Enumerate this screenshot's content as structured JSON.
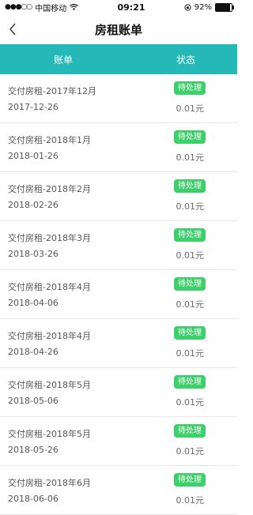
{
  "status_bar": {
    "carrier": "中国移动",
    "time": "09:21",
    "battery": "92%",
    "battery_level": 0.92
  },
  "nav": {
    "title": "房租账单"
  },
  "table_header": {
    "bill": "账单",
    "status": "状态"
  },
  "items": [
    {
      "title": "交付房租-2017年12月",
      "date": "2017-12-26",
      "status": "待处理",
      "amount": "0.01元"
    },
    {
      "title": "交付房租-2018年1月",
      "date": "2018-01-26",
      "status": "待处理",
      "amount": "0.01元"
    },
    {
      "title": "交付房租-2018年2月",
      "date": "2018-02-26",
      "status": "待处理",
      "amount": "0.01元"
    },
    {
      "title": "交付房租-2018年3月",
      "date": "2018-03-26",
      "status": "待处理",
      "amount": "0.01元"
    },
    {
      "title": "交付房租-2018年4月",
      "date": "2018-04-06",
      "status": "待处理",
      "amount": "0.01元"
    },
    {
      "title": "交付房租-2018年4月",
      "date": "2018-04-26",
      "status": "待处理",
      "amount": "0.01元"
    },
    {
      "title": "交付房租-2018年5月",
      "date": "2018-05-06",
      "status": "待处理",
      "amount": "0.01元"
    },
    {
      "title": "交付房租-2018年5月",
      "date": "2018-05-26",
      "status": "待处理",
      "amount": "0.01元"
    },
    {
      "title": "交付房租-2018年6月",
      "date": "2018-06-06",
      "status": "待处理",
      "amount": "0.01元"
    }
  ],
  "colors": {
    "header_bg": "#24b9b6",
    "badge_bg": "#3ccf6a"
  }
}
